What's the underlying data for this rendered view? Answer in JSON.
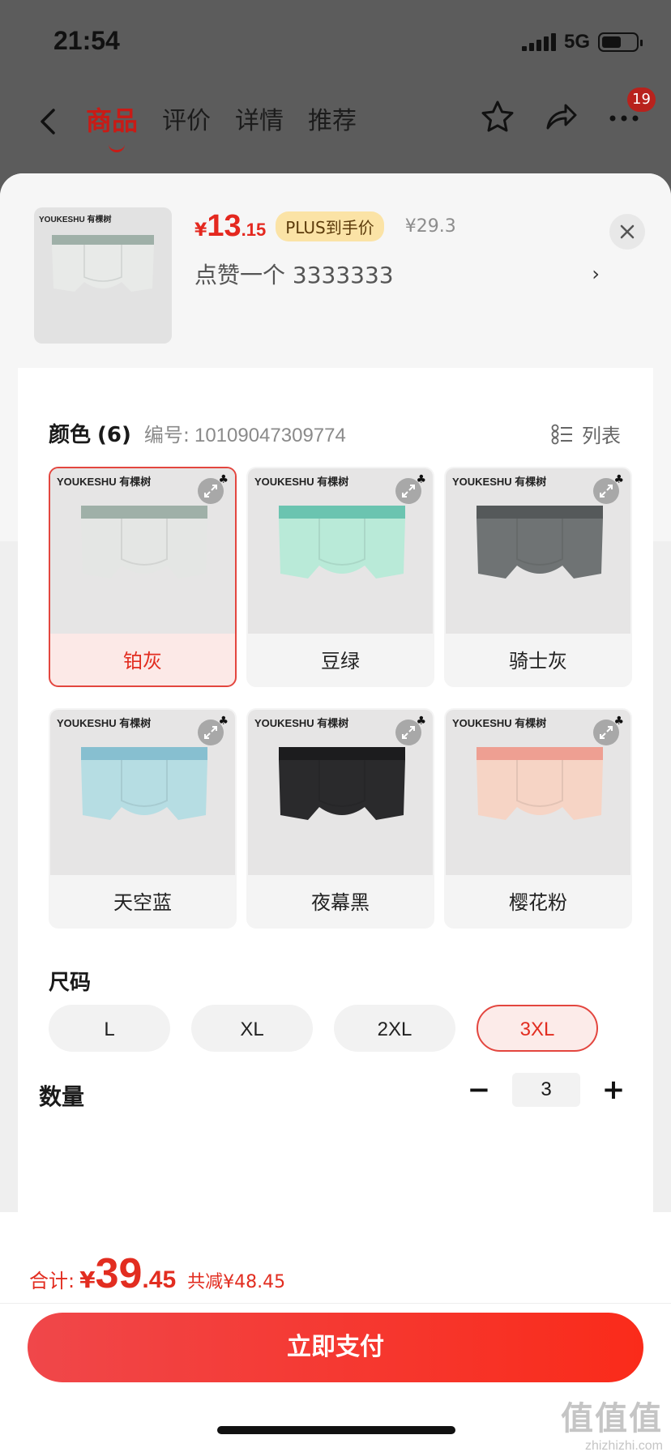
{
  "status": {
    "time": "21:54",
    "network": "5G"
  },
  "nav": {
    "tabs": [
      "商品",
      "评价",
      "详情",
      "推荐"
    ],
    "badge": "19"
  },
  "product": {
    "thumb_brand": "YOUKESHU 有棵树",
    "price_currency": "¥",
    "price_int": "13",
    "price_dec": ".15",
    "plus_label": "PLUS到手价",
    "original_price": "¥29.3",
    "selection_text": "点赞一个  3333333",
    "arrow": "›"
  },
  "color": {
    "title": "颜色",
    "count": "(6)",
    "code_label": "编号:",
    "code": "10109047309774",
    "list_label": "列表",
    "options": [
      {
        "label": "铂灰",
        "brand": "YOUKESHU 有棵树",
        "body": "#e4e6e4",
        "band": "#9fb0a8",
        "selected": true
      },
      {
        "label": "豆绿",
        "brand": "YOUKESHU 有棵树",
        "body": "#b9ead8",
        "band": "#6bc4b0",
        "selected": false
      },
      {
        "label": "骑士灰",
        "brand": "YOUKESHU 有棵树",
        "body": "#6f7374",
        "band": "#55595a",
        "selected": false
      },
      {
        "label": "天空蓝",
        "brand": "YOUKESHU 有棵树",
        "body": "#b6dde3",
        "band": "#87bfd0",
        "selected": false
      },
      {
        "label": "夜幕黑",
        "brand": "YOUKESHU 有棵树",
        "body": "#2a2a2c",
        "band": "#1c1c1e",
        "selected": false
      },
      {
        "label": "樱花粉",
        "brand": "YOUKESHU 有棵树",
        "body": "#f6d4c5",
        "band": "#ee9f92",
        "selected": false
      }
    ]
  },
  "size": {
    "title": "尺码",
    "options": [
      "L",
      "XL",
      "2XL",
      "3XL"
    ],
    "selected": "3XL"
  },
  "quantity": {
    "title": "数量",
    "minus": "−",
    "value": "3",
    "plus": "+"
  },
  "total": {
    "label": "合计:",
    "currency": "¥",
    "int": "39",
    "dec": ".45",
    "saving": "共减¥48.45"
  },
  "pay_button": "立即支付",
  "watermark": {
    "main": "值值值",
    "sub": "zhizhizhi.com"
  },
  "colors": {
    "accent": "#e22d20",
    "plus_badge": "#fbe3a6"
  }
}
